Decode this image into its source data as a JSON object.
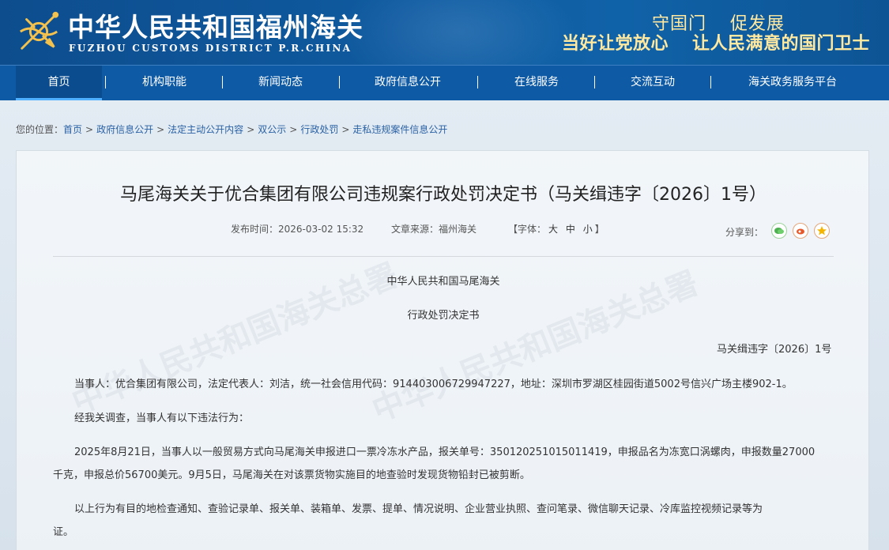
{
  "header": {
    "title": "中华人民共和国福州海关",
    "subtitle": "FUZHOU CUSTOMS DISTRICT P.R.CHINA",
    "slogan_line1_a": "守国门",
    "slogan_line1_b": "促发展",
    "slogan_line2_a": "当好让党放心",
    "slogan_line2_b": "让人民满意的国门卫士",
    "brand_color": "#0f5aa5",
    "slogan_color": "#ffe9a0"
  },
  "nav": {
    "items": [
      {
        "label": "首页",
        "active": true
      },
      {
        "label": "机构职能"
      },
      {
        "label": "新闻动态"
      },
      {
        "label": "政府信息公开"
      },
      {
        "label": "在线服务"
      },
      {
        "label": "交流互动"
      },
      {
        "label": "海关政务服务平台"
      }
    ]
  },
  "breadcrumb": {
    "prefix": "您的位置：",
    "items": [
      "首页",
      "政府信息公开",
      "法定主动公开内容",
      "双公示",
      "行政处罚",
      "走私违规案件信息公开"
    ]
  },
  "article": {
    "title": "马尾海关关于优合集团有限公司违规案行政处罚决定书（马关缉违字〔2026〕1号）",
    "publish_label": "发布时间：",
    "publish_time": "2026-03-02 15:32",
    "source_label": "文章来源：",
    "source": "福州海关",
    "font_open": "【字体：",
    "font_sizes": [
      "大",
      "中",
      "小"
    ],
    "font_close": "】",
    "share_label": "分享到：",
    "share_icons": [
      "wechat-icon",
      "weibo-icon",
      "favorite-icon"
    ],
    "org": "中华人民共和国马尾海关",
    "doc_type": "行政处罚决定书",
    "doc_number": "马关缉违字〔2026〕1号",
    "para1": "当事人：优合集团有限公司，法定代表人：刘洁，统一社会信用代码：914403006729947227，地址：深圳市罗湖区桂园街道5002号信兴广场主楼902-1。",
    "para2": "经我关调查，当事人有以下违法行为：",
    "para3_line1": "2025年8月21日，当事人以一般贸易方式向马尾海关申报进口一票冷冻水产品，报关单号：350120251015011419，申报品名为冻宽口涡螺肉，申报数量27000",
    "para3_line2": "千克，申报总价56700美元。9月5日，马尾海关在对该票货物实施目的地查验时发现货物铅封已被剪断。",
    "para4_line1": "以上行为有目的地检查通知、查验记录单、报关单、装箱单、发票、提单、情况说明、企业营业执照、查问笔录、微信聊天记录、冷库监控视频记录等为",
    "para4_line2": "证。"
  },
  "watermark_text": "中华人民共和国海关总署"
}
